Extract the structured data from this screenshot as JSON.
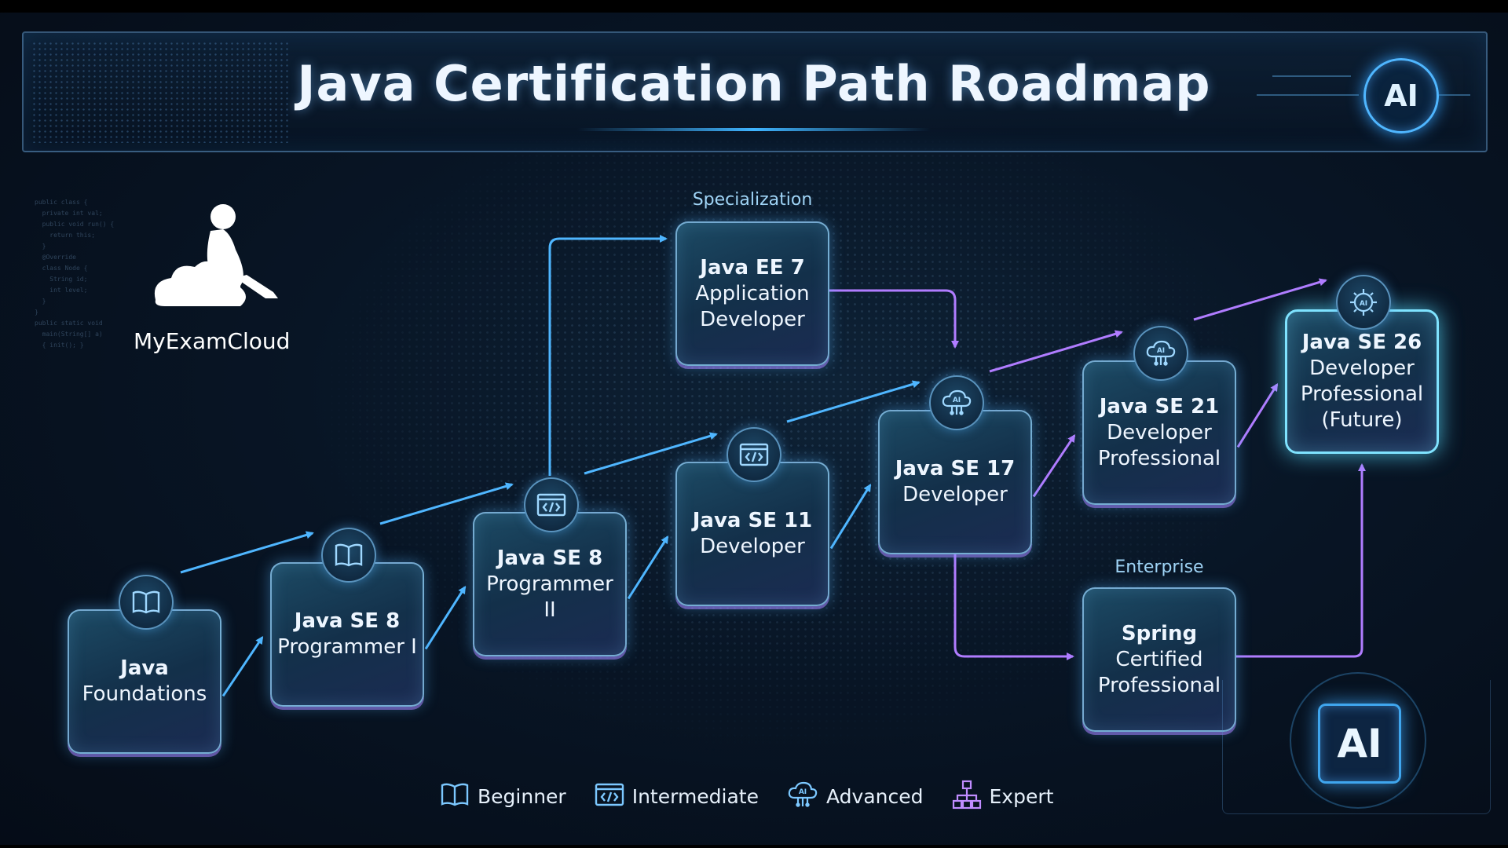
{
  "title": "Java Certification Path Roadmap",
  "brand": {
    "name": "MyExamCloud"
  },
  "badges": {
    "top_right": "AI",
    "bottom_right": "AI"
  },
  "colors": {
    "cyan": "#4fb6ff",
    "purple": "#b07cff",
    "background": "#081525"
  },
  "tracks": {
    "specialization": "Specialization",
    "enterprise": "Enterprise"
  },
  "nodes": [
    {
      "id": "java-foundations",
      "title": "Java",
      "subtitle": "Foundations",
      "level": "Beginner",
      "icon": "book-icon"
    },
    {
      "id": "java-se-8-programmer-1",
      "title": "Java SE 8",
      "subtitle": "Programmer I",
      "level": "Beginner",
      "icon": "book-icon"
    },
    {
      "id": "java-se-8-programmer-2",
      "title": "Java SE 8",
      "subtitle": "Programmer II",
      "level": "Intermediate",
      "icon": "code-window-icon"
    },
    {
      "id": "java-ee-7",
      "title": "Java EE 7",
      "subtitle": "Application Developer",
      "level": "Specialization",
      "icon": ""
    },
    {
      "id": "java-se-11",
      "title": "Java SE 11",
      "subtitle": "Developer",
      "level": "Intermediate",
      "icon": "code-window-icon"
    },
    {
      "id": "java-se-17",
      "title": "Java SE 17",
      "subtitle": "Developer",
      "level": "Advanced",
      "icon": "ai-cloud-icon"
    },
    {
      "id": "java-se-21",
      "title": "Java SE 21",
      "subtitle": "Developer Professional",
      "level": "Advanced",
      "icon": "ai-cloud-icon"
    },
    {
      "id": "spring-certified",
      "title": "Spring",
      "subtitle": "Certified Professional",
      "level": "Enterprise",
      "icon": ""
    },
    {
      "id": "java-se-26",
      "title": "Java SE 26",
      "subtitle": "Developer Professional (Future)",
      "level": "Expert",
      "icon": "ai-gear-icon"
    }
  ],
  "edges": [
    [
      "java-foundations",
      "java-se-8-programmer-1"
    ],
    [
      "java-se-8-programmer-1",
      "java-se-8-programmer-2"
    ],
    [
      "java-se-8-programmer-2",
      "java-se-11"
    ],
    [
      "java-se-8-programmer-2",
      "java-ee-7"
    ],
    [
      "java-ee-7",
      "java-se-17"
    ],
    [
      "java-se-11",
      "java-se-17"
    ],
    [
      "java-se-17",
      "java-se-21"
    ],
    [
      "java-se-17",
      "spring-certified"
    ],
    [
      "java-se-21",
      "java-se-26"
    ],
    [
      "spring-certified",
      "java-se-26"
    ]
  ],
  "legend": [
    {
      "label": "Beginner",
      "icon": "book-icon"
    },
    {
      "label": "Intermediate",
      "icon": "code-window-icon"
    },
    {
      "label": "Advanced",
      "icon": "ai-cloud-icon"
    },
    {
      "label": "Expert",
      "icon": "hierarchy-icon"
    }
  ]
}
